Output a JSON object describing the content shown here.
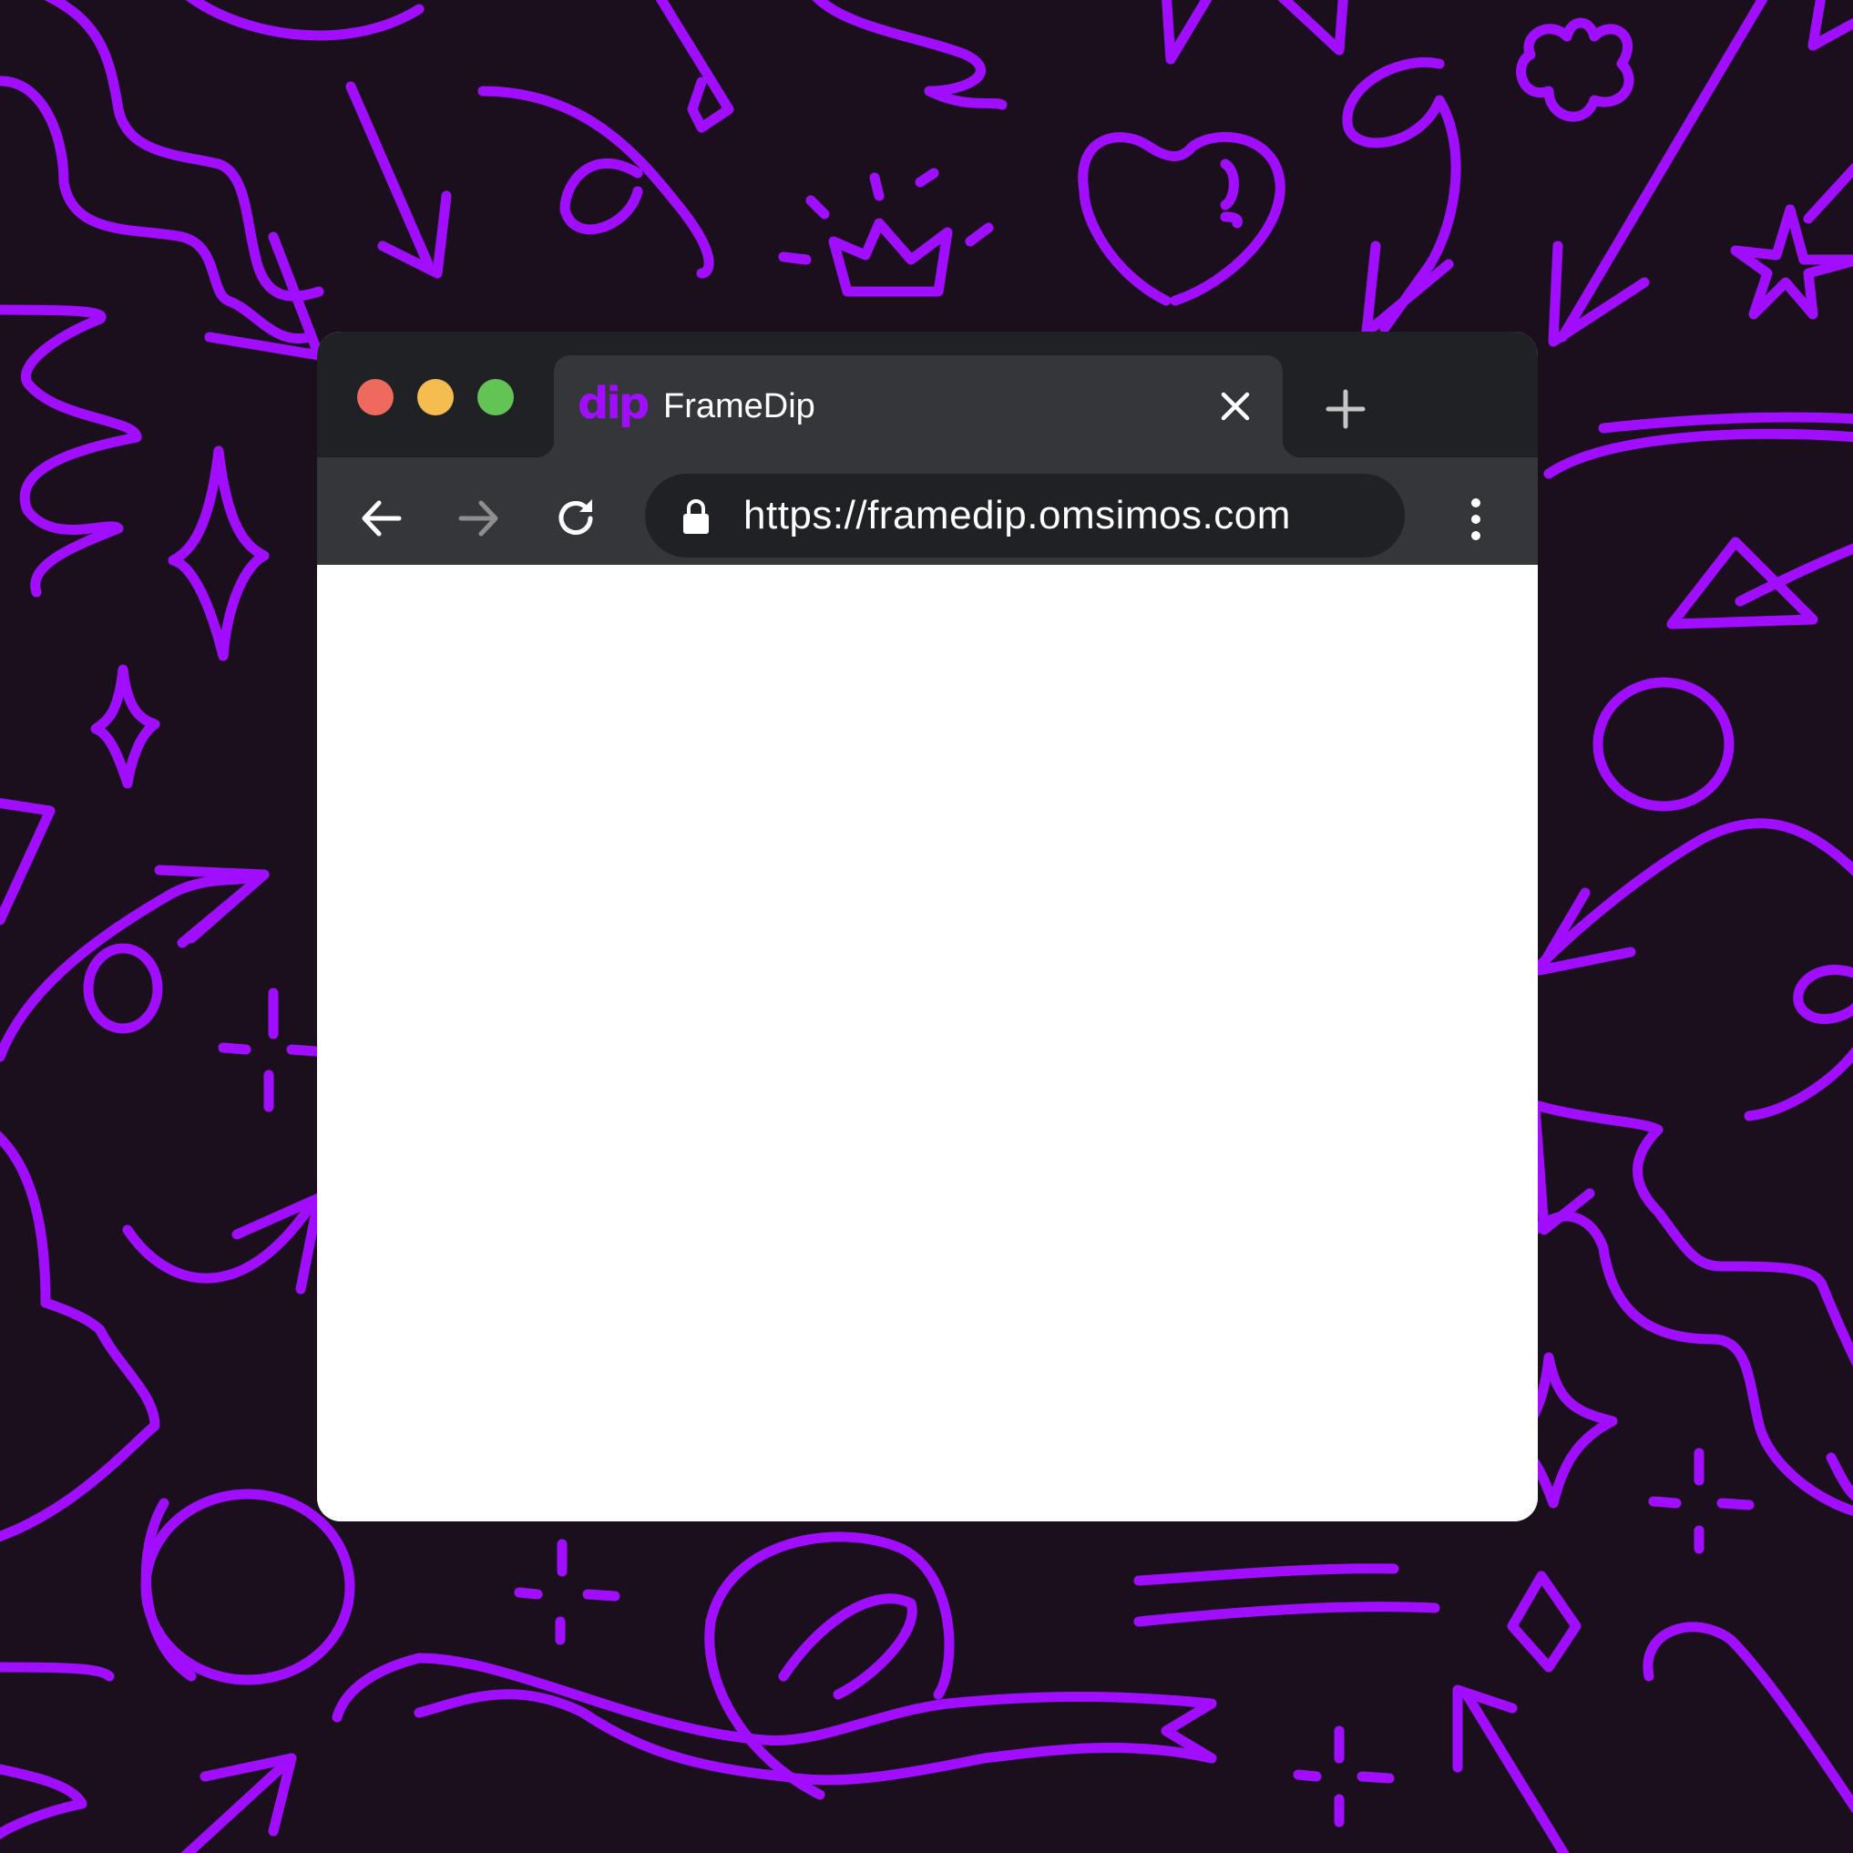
{
  "browser": {
    "tab": {
      "favicon_text": "dip",
      "title": "FrameDip"
    },
    "url": "https://framedip.omsimos.com",
    "icons": {
      "traffic_lights": [
        "close-window-icon",
        "minimize-window-icon",
        "maximize-window-icon"
      ],
      "tab_close": "close-icon",
      "new_tab": "plus-icon",
      "back": "arrow-left-icon",
      "forward": "arrow-right-icon",
      "reload": "reload-icon",
      "lock": "lock-icon",
      "menu": "kebab-menu-icon"
    }
  },
  "colors": {
    "background": "#1b0f1e",
    "doodle_accent": "#a10eff",
    "tab_strip": "#202124",
    "toolbar": "#35363a",
    "traffic_red": "#ee6a5f",
    "traffic_yellow": "#f5bd4f",
    "traffic_green": "#61c454"
  }
}
